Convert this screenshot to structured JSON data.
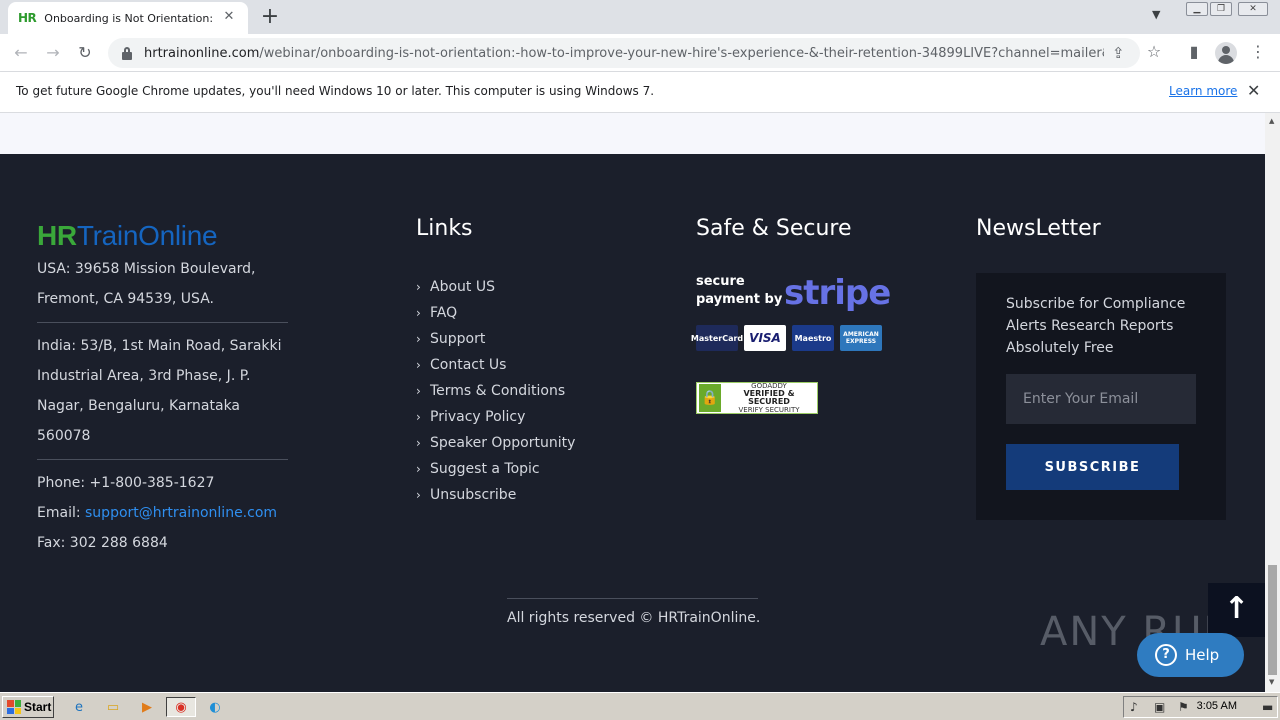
{
  "browser": {
    "tab": {
      "favicon_text": "HR",
      "title": "Onboarding is Not Orientation: How"
    },
    "url": {
      "host": "hrtrainonline.com",
      "path": "/webinar/onboarding-is-not-orientation:-how-to-improve-your-new-hire's-experience-&-their-retention-34899LIVE?channel=mailer&camp..."
    },
    "infobar": {
      "message": "To get future Google Chrome updates, you'll need Windows 10 or later. This computer is using Windows 7.",
      "link": "Learn more"
    }
  },
  "footer": {
    "logo": {
      "hr": "HR",
      "rest": "TrainOnline"
    },
    "address": {
      "usa": "USA: 39658 Mission Boulevard, Fremont, CA 94539, USA.",
      "india": "India: 53/B, 1st Main Road, Sarakki Industrial Area, 3rd Phase, J. P. Nagar, Bengaluru, Karnataka 560078",
      "phone": "Phone: +1-800-385-1627",
      "email_label": "Email: ",
      "email": "support@hrtrainonline.com",
      "fax": "Fax: 302 288 6884"
    },
    "links": {
      "heading": "Links",
      "items": [
        "About US",
        "FAQ",
        "Support",
        "Contact Us",
        "Terms & Conditions",
        "Privacy Policy",
        "Speaker Opportunity",
        "Suggest a Topic",
        "Unsubscribe"
      ]
    },
    "secure": {
      "heading": "Safe & Secure",
      "stripe_line1": "secure",
      "stripe_line2": "payment by",
      "stripe_word": "stripe",
      "cards": [
        "MasterCard",
        "VISA",
        "Maestro",
        "AMERICAN EXPRESS"
      ],
      "godaddy_top": "GODADDY",
      "godaddy_main": "VERIFIED & SECURED",
      "godaddy_bottom": "VERIFY SECURITY"
    },
    "newsletter": {
      "heading": "NewsLetter",
      "text": "Subscribe for Compliance Alerts Research Reports Absolutely Free",
      "placeholder": "Enter Your Email",
      "button": "SUBSCRIBE"
    },
    "copyright": "All rights reserved © HRTrainOnline."
  },
  "widgets": {
    "help": "Help",
    "watermark": "ANY RUN"
  },
  "taskbar": {
    "start": "Start",
    "clock": "3:05 AM"
  },
  "colors": {
    "footer_bg": "#1b1f2b",
    "logo_green": "#3aa83a",
    "logo_blue": "#1565c0",
    "subscribe_bg": "#143b7a",
    "stripe_purple": "#6772e5",
    "link_blue": "#2f8ff0"
  }
}
